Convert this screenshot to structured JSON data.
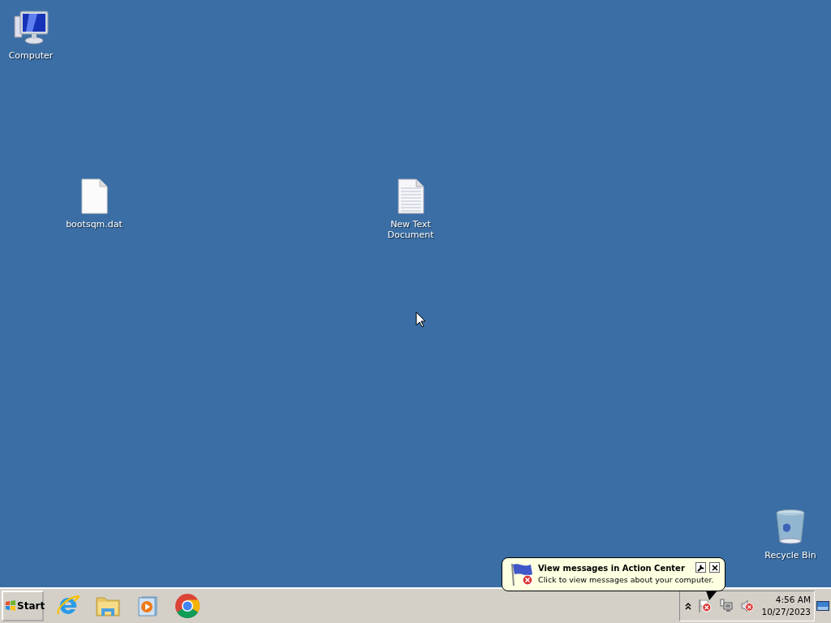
{
  "desktop": {
    "icons": [
      {
        "label": "Computer",
        "kind": "computer"
      },
      {
        "label": "bootsqm.dat",
        "kind": "file"
      },
      {
        "label": "New Text Document",
        "kind": "text"
      },
      {
        "label": "Recycle Bin",
        "kind": "recycle"
      }
    ]
  },
  "balloon": {
    "title": "View messages in Action Center",
    "text": "Click to view messages about your computer."
  },
  "taskbar": {
    "start": {
      "label": "Start"
    },
    "pinned": [
      {
        "kind": "ie"
      },
      {
        "kind": "explorer"
      },
      {
        "kind": "media"
      },
      {
        "kind": "chrome"
      }
    ],
    "tray": [
      {
        "kind": "flag"
      },
      {
        "kind": "network"
      },
      {
        "kind": "speaker"
      }
    ],
    "clock": {
      "time": "4:56 AM",
      "date": "10/27/2023"
    }
  }
}
